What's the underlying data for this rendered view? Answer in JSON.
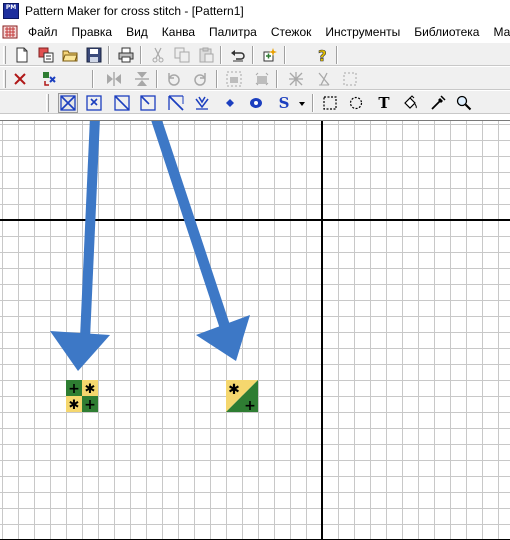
{
  "window": {
    "title": "Pattern Maker for cross stitch - [Pattern1]",
    "app_icon_text": "PM"
  },
  "menu": {
    "items": [
      "Файл",
      "Правка",
      "Вид",
      "Канва",
      "Палитра",
      "Стежок",
      "Инструменты",
      "Библиотека",
      "Ма"
    ]
  },
  "toolbars": {
    "standard": [
      "new",
      "open-template",
      "open",
      "save",
      "print",
      "cut",
      "copy",
      "paste",
      "undo",
      "add-stitch",
      "help"
    ],
    "edit": [
      "delete",
      "color-swap",
      "mirror-horizontal",
      "mirror-vertical",
      "rotate-left",
      "rotate-right",
      "select-color",
      "fill-similar",
      "clear-stitch",
      "clear-half",
      "select-area"
    ],
    "stitch": [
      "full-stitch",
      "quarter-stitch",
      "half-stitch",
      "three-quarter-stitch",
      "petite-stitch",
      "french-knot",
      "bead",
      "eyelet",
      "backstitch",
      "rectangle-select",
      "lasso-select",
      "text",
      "fill",
      "eyedropper",
      "zoom"
    ],
    "stitch_text_glyph": "S",
    "text_tool_glyph": "T"
  },
  "colors": {
    "accent": "#1c3fbf",
    "arrow": "#3d78c6",
    "stitch_green": "#2e7d32",
    "stitch_yellow": "#f5d76e",
    "grid_minor": "#c8c8c8",
    "grid_major": "#000000"
  },
  "canvas": {
    "stitch_symbols": {
      "quarter_top_left": "+",
      "quarter_top_right": "✱",
      "quarter_bottom_left": "✱",
      "quarter_bottom_right": "+",
      "half_top_left": "✱",
      "half_bottom_right": "+"
    }
  }
}
